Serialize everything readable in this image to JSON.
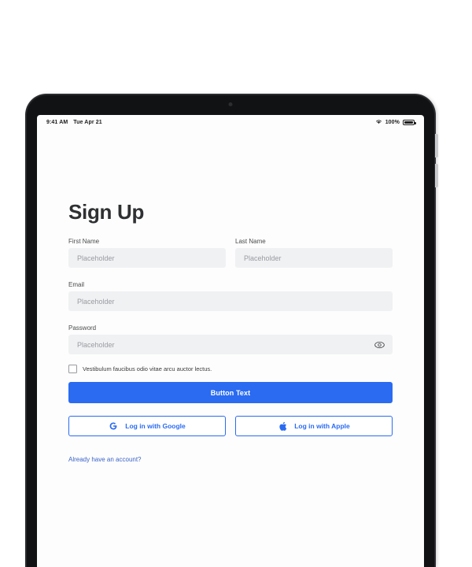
{
  "device": {
    "camera_icon": "camera-dot",
    "buttons": [
      "volume-up",
      "volume-down"
    ]
  },
  "status_bar": {
    "time": "9:41 AM",
    "date": "Tue Apr 21",
    "wifi_icon": "wifi-icon",
    "battery_percent": "100%",
    "battery_icon": "battery-icon"
  },
  "page": {
    "title": "Sign Up"
  },
  "form": {
    "first_name": {
      "label": "First Name",
      "placeholder": "Placeholder",
      "value": ""
    },
    "last_name": {
      "label": "Last Name",
      "placeholder": "Placeholder",
      "value": ""
    },
    "email": {
      "label": "Email",
      "placeholder": "Placeholder",
      "value": ""
    },
    "password": {
      "label": "Password",
      "placeholder": "Placeholder",
      "value": "",
      "toggle_icon": "eye-icon"
    },
    "terms": {
      "label": "Vestibulum faucibus odio vitae arcu auctor lectus.",
      "checked": false
    },
    "submit": {
      "label": "Button Text"
    }
  },
  "social": [
    {
      "label": "Log in with Google",
      "icon": "google-icon"
    },
    {
      "label": "Log in with Apple",
      "icon": "apple-icon"
    }
  ],
  "footer": {
    "login_link": "Already have an account?"
  },
  "colors": {
    "accent": "#2a6bf2",
    "link": "#3b63c7",
    "input_bg": "#f0f1f3",
    "placeholder": "#9a9ba0",
    "title": "#2f3032",
    "screen_bg": "#fdfdfd",
    "bezel": "#111214"
  }
}
